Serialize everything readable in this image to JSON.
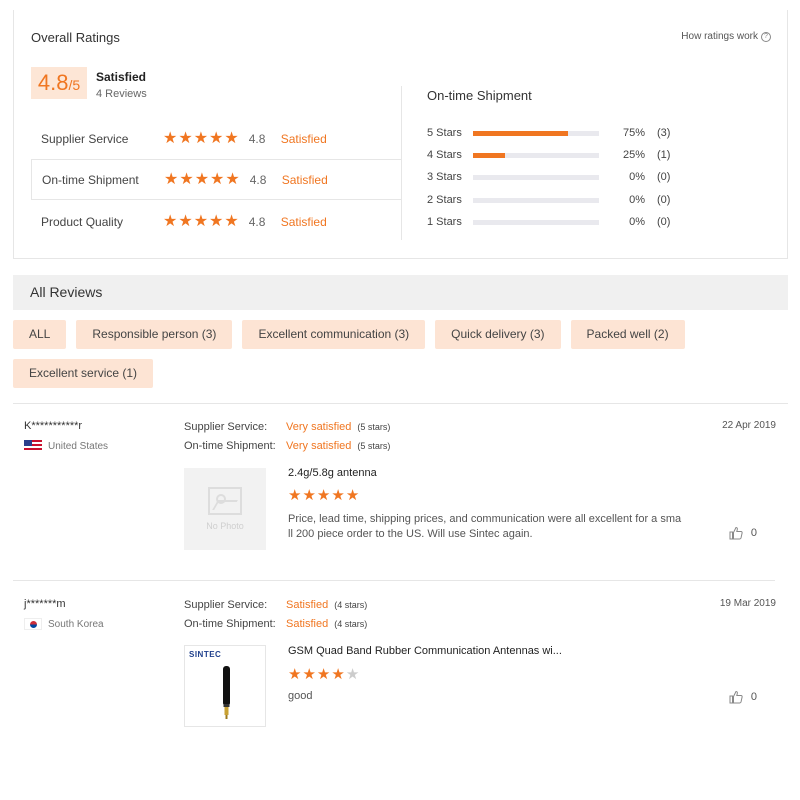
{
  "overall": {
    "title": "Overall Ratings",
    "how_link": "How ratings work",
    "score": "4.8",
    "score_suffix": "/5",
    "label": "Satisfied",
    "reviews": "4 Reviews"
  },
  "categories": [
    {
      "name": "Supplier Service",
      "score": "4.8",
      "label": "Satisfied",
      "stars": 5
    },
    {
      "name": "On-time Shipment",
      "score": "4.8",
      "label": "Satisfied",
      "stars": 5
    },
    {
      "name": "Product Quality",
      "score": "4.8",
      "label": "Satisfied",
      "stars": 5
    }
  ],
  "distribution": {
    "title": "On-time Shipment",
    "rows": [
      {
        "label": "5  Stars",
        "percent": "75%",
        "count": "(3)",
        "fill": 0.75
      },
      {
        "label": "4  Stars",
        "percent": "25%",
        "count": "(1)",
        "fill": 0.25
      },
      {
        "label": "3  Stars",
        "percent": "0%",
        "count": "(0)",
        "fill": 0
      },
      {
        "label": "2  Stars",
        "percent": "0%",
        "count": "(0)",
        "fill": 0
      },
      {
        "label": "1  Stars",
        "percent": "0%",
        "count": "(0)",
        "fill": 0
      }
    ]
  },
  "all_reviews": {
    "title": "All Reviews",
    "filters": [
      "ALL",
      "Responsible person (3)",
      "Excellent communication (3)",
      "Quick delivery (3)",
      "Packed well (2)",
      "Excellent service (1)"
    ]
  },
  "reviews": [
    {
      "user": "K***********r",
      "country": "United States",
      "supplier_key": "Supplier Service:",
      "supplier_val": "Very satisfied",
      "supplier_stars": "(5 stars)",
      "shipment_key": "On-time Shipment:",
      "shipment_val": "Very satisfied",
      "shipment_stars": "(5 stars)",
      "date": "22 Apr 2019",
      "photo_text": "No Photo",
      "product": "2.4g/5.8g antenna",
      "rating": 5,
      "text": "Price, lead time, shipping prices, and communication were all excellent for a small 200 piece order to the US. Will use Sintec again.",
      "likes": "0"
    },
    {
      "user": "j*******m",
      "country": "South Korea",
      "supplier_key": "Supplier Service:",
      "supplier_val": "Satisfied",
      "supplier_stars": "(4 stars)",
      "shipment_key": "On-time Shipment:",
      "shipment_val": "Satisfied",
      "shipment_stars": "(4 stars)",
      "date": "19 Mar 2019",
      "brand": "SINTEC",
      "product": "GSM Quad Band Rubber Communication Antennas wi...",
      "rating": 4,
      "text": "good",
      "likes": "0"
    }
  ],
  "colors": {
    "accent": "#f07621",
    "tag_bg": "#fde4d4",
    "score_bg": "#fde6d6",
    "header_bg": "#f0f0f0"
  }
}
